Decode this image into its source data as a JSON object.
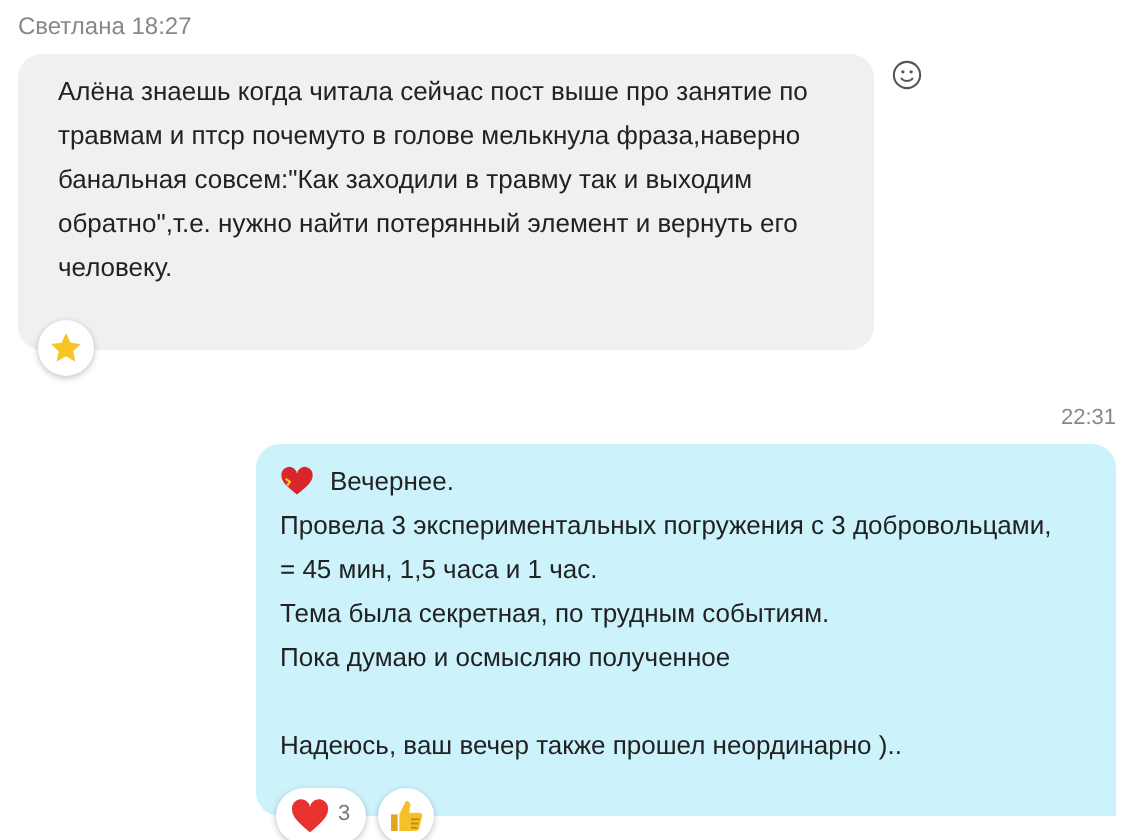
{
  "messages": [
    {
      "kind": "incoming",
      "sender": "Светлана",
      "time": "18:27",
      "text": "Алёна знаешь когда читала сейчас пост выше про занятие по травмам и птср почемуто в голове мелькнула фраза,наверно банальная совсем:\"Как заходили в травму так и выходим обратно\",т.е. нужно найти потерянный элемент и вернуть его человеку.",
      "reactions": [
        {
          "kind": "star"
        }
      ]
    },
    {
      "kind": "outgoing",
      "time": "22:31",
      "paragraphs": [
        {
          "lines": [
            "Вечернее.",
            "Провела 3 экспериментальных погружения с 3 добровольцами,",
            "= 45 мин, 1,5 часа и 1 час.",
            "Тема была секретная, по трудным событиям.",
            "Пока думаю и осмысляю полученное"
          ]
        },
        {
          "lines": [
            "Надеюсь, ваш вечер также прошел неординарно ).."
          ]
        }
      ],
      "reactions": [
        {
          "kind": "heart",
          "count": "3"
        },
        {
          "kind": "thumbs"
        }
      ]
    }
  ]
}
